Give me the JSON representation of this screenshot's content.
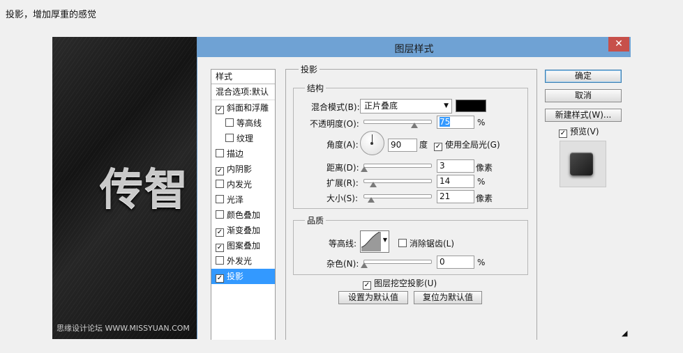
{
  "caption": "投影，增加厚重的感觉",
  "canvas": {
    "art_text": "传智",
    "watermark": "思缘设计论坛 WWW.MISSYUAN.COM"
  },
  "dialog": {
    "title": "图层样式",
    "close": "✕",
    "styles_panel": {
      "header": "样式",
      "blend_options": "混合选项:默认",
      "items": [
        {
          "label": "斜面和浮雕",
          "checked": true
        },
        {
          "label": "等高线",
          "checked": false,
          "sub": true
        },
        {
          "label": "纹理",
          "checked": false,
          "sub": true
        },
        {
          "label": "描边",
          "checked": false
        },
        {
          "label": "内阴影",
          "checked": true
        },
        {
          "label": "内发光",
          "checked": false
        },
        {
          "label": "光泽",
          "checked": false
        },
        {
          "label": "颜色叠加",
          "checked": false
        },
        {
          "label": "渐变叠加",
          "checked": true
        },
        {
          "label": "图案叠加",
          "checked": true
        },
        {
          "label": "外发光",
          "checked": false
        },
        {
          "label": "投影",
          "checked": true,
          "selected": true
        }
      ]
    },
    "drop_shadow": {
      "section": "投影",
      "structure": {
        "legend": "结构",
        "blend_mode_label": "混合模式(B):",
        "blend_mode_value": "正片叠底",
        "shadow_color": "#000000",
        "opacity_label": "不透明度(O):",
        "opacity_value": "75",
        "opacity_unit": "%",
        "angle_label": "角度(A):",
        "angle_value": "90",
        "angle_unit": "度",
        "global_light_label": "使用全局光(G)",
        "global_light_checked": true,
        "distance_label": "距离(D):",
        "distance_value": "3",
        "distance_unit": "像素",
        "spread_label": "扩展(R):",
        "spread_value": "14",
        "spread_unit": "%",
        "size_label": "大小(S):",
        "size_value": "21",
        "size_unit": "像素"
      },
      "quality": {
        "legend": "品质",
        "contour_label": "等高线:",
        "antialias_label": "消除锯齿(L)",
        "antialias_checked": false,
        "noise_label": "杂色(N):",
        "noise_value": "0",
        "noise_unit": "%"
      },
      "knockout_label": "图层挖空投影(U)",
      "knockout_checked": true,
      "make_default": "设置为默认值",
      "reset_default": "复位为默认值"
    },
    "buttons": {
      "ok": "确定",
      "cancel": "取消",
      "new_style": "新建样式(W)...",
      "preview_label": "预览(V)",
      "preview_checked": true
    }
  },
  "sliders": {
    "opacity": 0.75,
    "distance": 0.0,
    "spread": 0.14,
    "size": 0.1,
    "noise": 0.0
  },
  "colors": {
    "titlebar": "#6fa2d4",
    "close": "#c7504a",
    "selection": "#3399ff"
  }
}
